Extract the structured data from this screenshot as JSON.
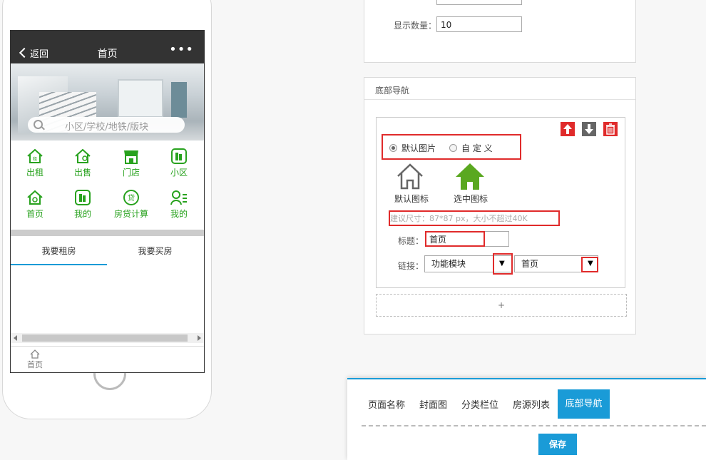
{
  "phone": {
    "appbar": {
      "back_label": "返回",
      "title": "首页",
      "more": "•••"
    },
    "search_placeholder": "小区/学校/地铁/版块",
    "grid_items": [
      {
        "label": "出租",
        "icon": "home-rent-icon"
      },
      {
        "label": "出售",
        "icon": "home-sale-icon"
      },
      {
        "label": "门店",
        "icon": "store-icon"
      },
      {
        "label": "小区",
        "icon": "building-icon"
      },
      {
        "label": "首页",
        "icon": "home-icon"
      },
      {
        "label": "我的",
        "icon": "building-icon"
      },
      {
        "label": "房贷计算",
        "icon": "loan-icon"
      },
      {
        "label": "我的",
        "icon": "user-list-icon"
      }
    ],
    "tabs": [
      "我要租房",
      "我要买房"
    ],
    "bottom_nav": {
      "label": "首页",
      "icon": "home-outline-icon"
    }
  },
  "top_panel": {
    "count_label": "显示数量：",
    "count_value": "10"
  },
  "nav_panel": {
    "title": "底部导航",
    "radio_default": "默认图片",
    "radio_custom": "自 定 义",
    "default_icon_label": "默认图标",
    "selected_icon_label": "选中图标",
    "size_hint": "建议尺寸：87*87 px，大小不超过40K",
    "title_label": "标题：",
    "title_value": "首页",
    "link_label": "链接：",
    "link_type": "功能模块",
    "link_target": "首页",
    "add_label": "+"
  },
  "bottom_tabs": {
    "items": [
      "页面名称",
      "封面图",
      "分类栏位",
      "房源列表"
    ],
    "active": "底部导航",
    "save_label": "保存"
  },
  "colors": {
    "accent": "#1a9bd7",
    "green": "#28a21e",
    "red": "#e02b2b"
  }
}
